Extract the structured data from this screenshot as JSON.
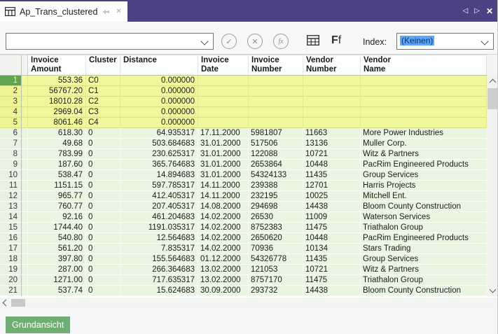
{
  "tab_bar": {
    "active_tab": {
      "title": "Ap_Trans_clustered"
    }
  },
  "toolbar": {
    "expression_input": {
      "value": "",
      "placeholder": ""
    },
    "index_label": "Index:",
    "index_select": {
      "value": "(Keinen)"
    }
  },
  "grid": {
    "columns": [
      {
        "key": "invoice_amount",
        "label": "Invoice\nAmount",
        "align": "right"
      },
      {
        "key": "cluster",
        "label": "Cluster",
        "align": "left"
      },
      {
        "key": "distance",
        "label": "Distance",
        "align": "right"
      },
      {
        "key": "invoice_date",
        "label": "Invoice\nDate",
        "align": "left"
      },
      {
        "key": "invoice_number",
        "label": "Invoice\nNumber",
        "align": "left"
      },
      {
        "key": "vendor_number",
        "label": "Vendor\nNumber",
        "align": "left"
      },
      {
        "key": "vendor_name",
        "label": "Vendor\nName",
        "align": "left"
      }
    ],
    "rows": [
      {
        "num": 1,
        "invoice_amount": "553.36",
        "cluster": "C0",
        "distance": "0.000000",
        "invoice_date": "",
        "invoice_number": "",
        "vendor_number": "",
        "vendor_name": "",
        "highlighted": true,
        "selected": true
      },
      {
        "num": 2,
        "invoice_amount": "56767.20",
        "cluster": "C1",
        "distance": "0.000000",
        "invoice_date": "",
        "invoice_number": "",
        "vendor_number": "",
        "vendor_name": "",
        "highlighted": true,
        "selected": false
      },
      {
        "num": 3,
        "invoice_amount": "18010.28",
        "cluster": "C2",
        "distance": "0.000000",
        "invoice_date": "",
        "invoice_number": "",
        "vendor_number": "",
        "vendor_name": "",
        "highlighted": true,
        "selected": false
      },
      {
        "num": 4,
        "invoice_amount": "2969.04",
        "cluster": "C3",
        "distance": "0.000000",
        "invoice_date": "",
        "invoice_number": "",
        "vendor_number": "",
        "vendor_name": "",
        "highlighted": true,
        "selected": false
      },
      {
        "num": 5,
        "invoice_amount": "8061.46",
        "cluster": "C4",
        "distance": "0.000000",
        "invoice_date": "",
        "invoice_number": "",
        "vendor_number": "",
        "vendor_name": "",
        "highlighted": true,
        "selected": false
      },
      {
        "num": 6,
        "invoice_amount": "618.30",
        "cluster": "0",
        "distance": "64.935317",
        "invoice_date": "17.11.2000",
        "invoice_number": "5981807",
        "vendor_number": "11663",
        "vendor_name": "More Power Industries",
        "highlighted": false,
        "selected": false
      },
      {
        "num": 7,
        "invoice_amount": "49.68",
        "cluster": "0",
        "distance": "503.684683",
        "invoice_date": "31.01.2000",
        "invoice_number": "517506",
        "vendor_number": "13136",
        "vendor_name": "Muller Corp.",
        "highlighted": false,
        "selected": false
      },
      {
        "num": 8,
        "invoice_amount": "783.99",
        "cluster": "0",
        "distance": "230.625317",
        "invoice_date": "31.01.2000",
        "invoice_number": "122088",
        "vendor_number": "10721",
        "vendor_name": "Witz & Partners",
        "highlighted": false,
        "selected": false
      },
      {
        "num": 9,
        "invoice_amount": "187.60",
        "cluster": "0",
        "distance": "365.764683",
        "invoice_date": "31.01.2000",
        "invoice_number": "2653864",
        "vendor_number": "10448",
        "vendor_name": "PacRim Engineered Products",
        "highlighted": false,
        "selected": false
      },
      {
        "num": 10,
        "invoice_amount": "538.47",
        "cluster": "0",
        "distance": "14.894683",
        "invoice_date": "31.01.2000",
        "invoice_number": "54324133",
        "vendor_number": "11435",
        "vendor_name": "Group Services",
        "highlighted": false,
        "selected": false
      },
      {
        "num": 11,
        "invoice_amount": "1151.15",
        "cluster": "0",
        "distance": "597.785317",
        "invoice_date": "14.11.2000",
        "invoice_number": "239388",
        "vendor_number": "12701",
        "vendor_name": "Harris Projects",
        "highlighted": false,
        "selected": false
      },
      {
        "num": 12,
        "invoice_amount": "965.77",
        "cluster": "0",
        "distance": "412.405317",
        "invoice_date": "14.11.2000",
        "invoice_number": "232195",
        "vendor_number": "10025",
        "vendor_name": "Mitchell Ent.",
        "highlighted": false,
        "selected": false
      },
      {
        "num": 13,
        "invoice_amount": "760.77",
        "cluster": "0",
        "distance": "207.405317",
        "invoice_date": "14.08.2000",
        "invoice_number": "294698",
        "vendor_number": "14438",
        "vendor_name": "Bloom County Construction",
        "highlighted": false,
        "selected": false
      },
      {
        "num": 14,
        "invoice_amount": "92.16",
        "cluster": "0",
        "distance": "461.204683",
        "invoice_date": "14.02.2000",
        "invoice_number": "26530",
        "vendor_number": "11009",
        "vendor_name": "Waterson Services",
        "highlighted": false,
        "selected": false
      },
      {
        "num": 15,
        "invoice_amount": "1744.40",
        "cluster": "0",
        "distance": "1191.035317",
        "invoice_date": "14.02.2000",
        "invoice_number": "8752383",
        "vendor_number": "11475",
        "vendor_name": "Triathalon Group",
        "highlighted": false,
        "selected": false
      },
      {
        "num": 16,
        "invoice_amount": "540.80",
        "cluster": "0",
        "distance": "12.564683",
        "invoice_date": "14.02.2000",
        "invoice_number": "2650620",
        "vendor_number": "10448",
        "vendor_name": "PacRim Engineered Products",
        "highlighted": false,
        "selected": false
      },
      {
        "num": 17,
        "invoice_amount": "561.20",
        "cluster": "0",
        "distance": "7.835317",
        "invoice_date": "14.02.2000",
        "invoice_number": "70936",
        "vendor_number": "10134",
        "vendor_name": "Stars Trading",
        "highlighted": false,
        "selected": false
      },
      {
        "num": 18,
        "invoice_amount": "397.80",
        "cluster": "0",
        "distance": "155.564683",
        "invoice_date": "01.12.2000",
        "invoice_number": "54326778",
        "vendor_number": "11435",
        "vendor_name": "Group Services",
        "highlighted": false,
        "selected": false
      },
      {
        "num": 19,
        "invoice_amount": "287.00",
        "cluster": "0",
        "distance": "266.364683",
        "invoice_date": "13.02.2000",
        "invoice_number": "121053",
        "vendor_number": "10721",
        "vendor_name": "Witz & Partners",
        "highlighted": false,
        "selected": false
      },
      {
        "num": 20,
        "invoice_amount": "1271.00",
        "cluster": "0",
        "distance": "717.635317",
        "invoice_date": "13.02.2000",
        "invoice_number": "8757170",
        "vendor_number": "11475",
        "vendor_name": "Triathalon Group",
        "highlighted": false,
        "selected": false
      },
      {
        "num": 21,
        "invoice_amount": "537.74",
        "cluster": "0",
        "distance": "15.624683",
        "invoice_date": "30.09.2000",
        "invoice_number": "293732",
        "vendor_number": "14438",
        "vendor_name": "Bloom County Construction",
        "highlighted": false,
        "selected": false
      }
    ]
  },
  "status_bar": {
    "view_label": "Grundansicht"
  },
  "colors": {
    "accent_purple": "#4b4284",
    "highlight_yellow": "#f1f79d",
    "row_green": "#e9f5e1",
    "selected_rownum_green": "#61a452",
    "badge_green": "#6fad73",
    "selection_blue": "#58a7f8"
  }
}
